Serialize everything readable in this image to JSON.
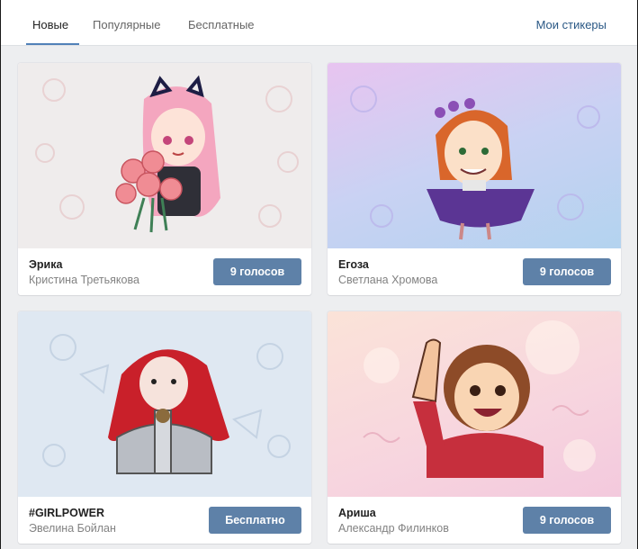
{
  "tabs": [
    {
      "label": "Новые",
      "active": true
    },
    {
      "label": "Популярные",
      "active": false
    },
    {
      "label": "Бесплатные",
      "active": false
    }
  ],
  "my_stickers_label": "Мои стикеры",
  "accent_color": "#5181b8",
  "button_color": "#5e81a8",
  "packs": [
    {
      "title": "Эрика",
      "author": "Кристина Третьякова",
      "button": "9 голосов"
    },
    {
      "title": "Егоза",
      "author": "Светлана Хромова",
      "button": "9 голосов"
    },
    {
      "title": "#GIRLPOWER",
      "author": "Эвелина Бойлан",
      "button": "Бесплатно"
    },
    {
      "title": "Ариша",
      "author": "Александр Филинков",
      "button": "9 голосов"
    }
  ]
}
